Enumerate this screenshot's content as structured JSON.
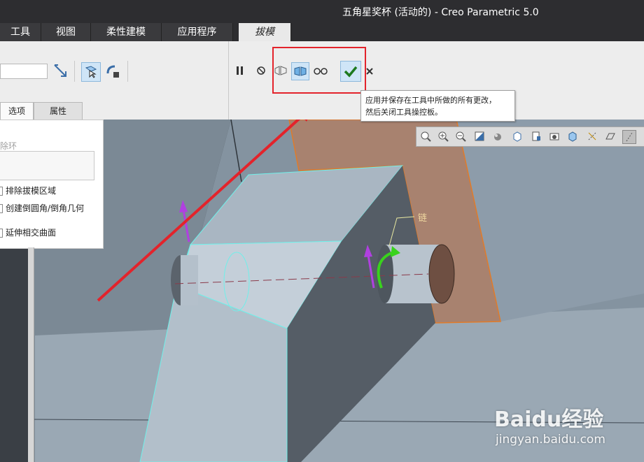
{
  "window": {
    "title": "五角星奖杯 (活动的) - Creo Parametric 5.0"
  },
  "ribbon_tabs": [
    {
      "label": "工具"
    },
    {
      "label": "视图"
    },
    {
      "label": "柔性建模"
    },
    {
      "label": "应用程序"
    },
    {
      "label": "拔模",
      "active": true
    }
  ],
  "panel_tabs": [
    {
      "label": "选项",
      "active": true
    },
    {
      "label": "属性"
    }
  ],
  "options_panel": {
    "group_label": "除环",
    "options": [
      {
        "label": "排除拔模区域"
      },
      {
        "label": "创建倒圆角/倒角几何"
      },
      {
        "label": "延伸相交曲面"
      }
    ]
  },
  "toolbar_icons": [
    "pause-icon",
    "stop-icon",
    "preview-icon",
    "verify-mode-icon",
    "glasses-icon",
    "ok-checkmark-icon",
    "cancel-x-icon"
  ],
  "tooltip": {
    "line1": "应用并保存在工具中所做的所有更改，",
    "line2": "然后关闭工具操控板。"
  },
  "model": {
    "chain_label": "链"
  },
  "watermark": {
    "brand": "Baidu经验",
    "url": "jingyan.baidu.com"
  },
  "colors": {
    "accent_highlight": "#e3232b",
    "selected_surface": "#a8826f",
    "edge_highlight": "#6ff0ea",
    "arrow_purple": "#b040e0",
    "arrow_green": "#39d21d",
    "confirm_green": "#1e7a1e"
  }
}
